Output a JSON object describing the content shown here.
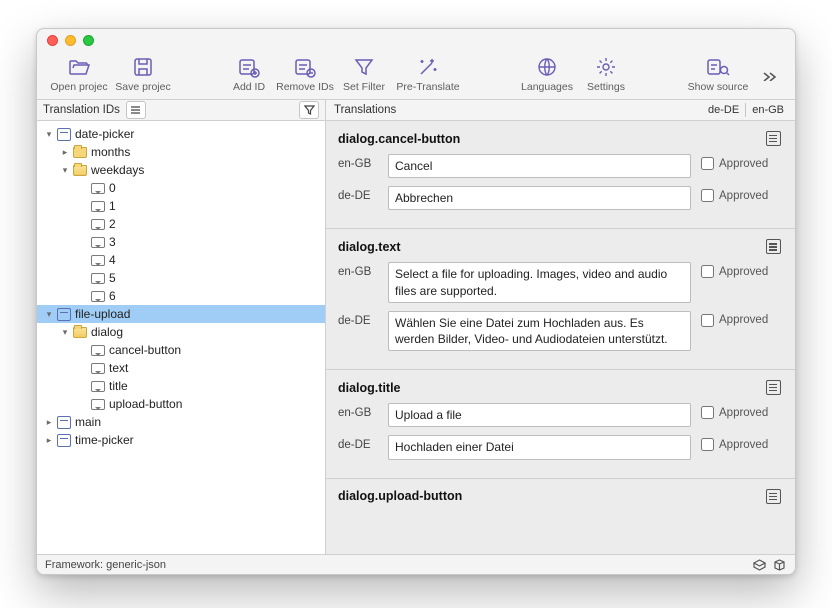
{
  "toolbar": {
    "open": "Open projec",
    "save": "Save projec",
    "add_id": "Add ID",
    "remove_ids": "Remove IDs",
    "set_filter": "Set Filter",
    "pretranslate": "Pre-Translate",
    "languages": "Languages",
    "settings": "Settings",
    "show_source": "Show source"
  },
  "panels": {
    "left_title": "Translation IDs",
    "right_title": "Translations",
    "lang_a": "de-DE",
    "lang_b": "en-GB"
  },
  "tree": {
    "date_picker": "date-picker",
    "months": "months",
    "weekdays": "weekdays",
    "wk0": "0",
    "wk1": "1",
    "wk2": "2",
    "wk3": "3",
    "wk4": "4",
    "wk5": "5",
    "wk6": "6",
    "file_upload": "file-upload",
    "dialog": "dialog",
    "cancel_button": "cancel-button",
    "text": "text",
    "title": "title",
    "upload_button": "upload-button",
    "main": "main",
    "time_picker": "time-picker"
  },
  "trans": {
    "lang_en": "en-GB",
    "lang_de": "de-DE",
    "approved": "Approved",
    "e1": {
      "key": "dialog.cancel-button",
      "en": "Cancel",
      "de": "Abbrechen"
    },
    "e2": {
      "key": "dialog.text",
      "en": "Select a file for uploading. Images, video and audio files are supported.",
      "de": "Wählen Sie eine Datei zum Hochladen aus. Es werden Bilder, Video- und Audiodateien unterstützt."
    },
    "e3": {
      "key": "dialog.title",
      "en": "Upload a file",
      "de": "Hochladen einer Datei"
    },
    "e4": {
      "key": "dialog.upload-button"
    }
  },
  "status": {
    "text": "Framework: generic-json"
  }
}
